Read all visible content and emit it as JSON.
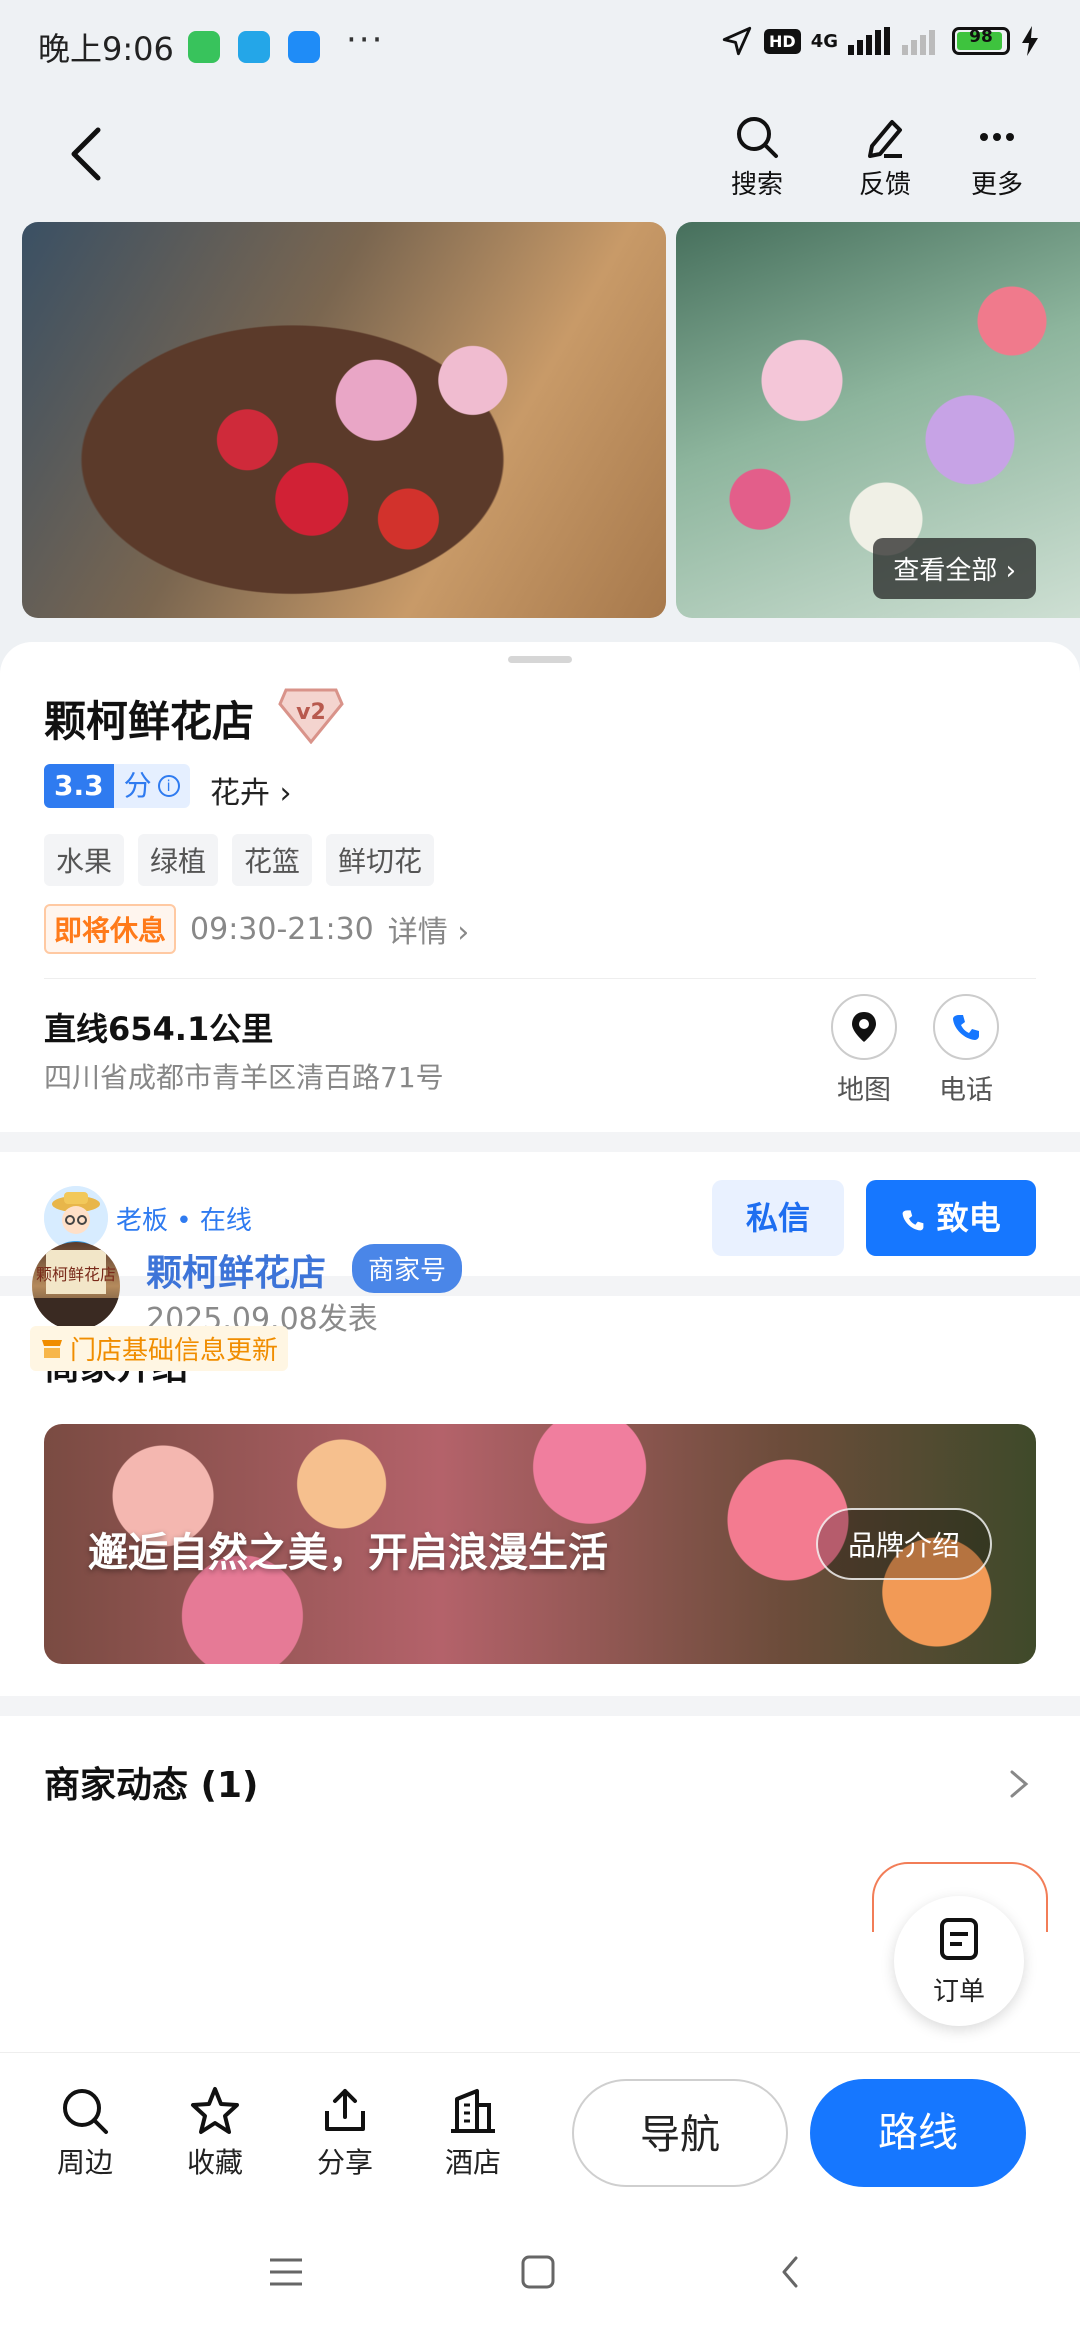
{
  "status_bar": {
    "time": "晚上9:06",
    "dots": "···",
    "hd": "HD",
    "network": "4G",
    "battery": "98"
  },
  "top_nav": {
    "search_label": "搜索",
    "feedback_label": "反馈",
    "more_label": "更多"
  },
  "gallery": {
    "view_all_label": "查看全部 ›"
  },
  "shop": {
    "name": "颗柯鲜花店",
    "level_badge": "v2",
    "score": "3.3",
    "score_unit": "分",
    "category": "花卉 ›",
    "tags": [
      "水果",
      "绿植",
      "花篮",
      "鲜切花"
    ],
    "closing_status": "即将休息",
    "hours": "09:30-21:30",
    "details_label": "详情 ›",
    "distance": "直线654.1公里",
    "address": "四川省成都市青羊区清百路71号",
    "map_label": "地图",
    "phone_label": "电话"
  },
  "owner": {
    "status_text": "老板 • 在线",
    "message_button": "私信",
    "call_button": "致电"
  },
  "intro": {
    "title": "商家介绍",
    "banner_text": "邂逅自然之美，开启浪漫生活",
    "brand_button": "品牌介绍"
  },
  "posts": {
    "title": "商家动态 (1)",
    "author": "颗柯鲜花店",
    "author_tag": "商家号",
    "date": "2025.09.08发表",
    "update_tag": "门店基础信息更新",
    "order_label": "订单"
  },
  "bottom_bar": {
    "nearby": "周边",
    "favorite": "收藏",
    "share": "分享",
    "hotel": "酒店",
    "navigate": "导航",
    "route": "路线"
  },
  "colors": {
    "accent": "#1677ff",
    "closing": "#ff7a1a",
    "score_bg": "#2f7bf0"
  }
}
